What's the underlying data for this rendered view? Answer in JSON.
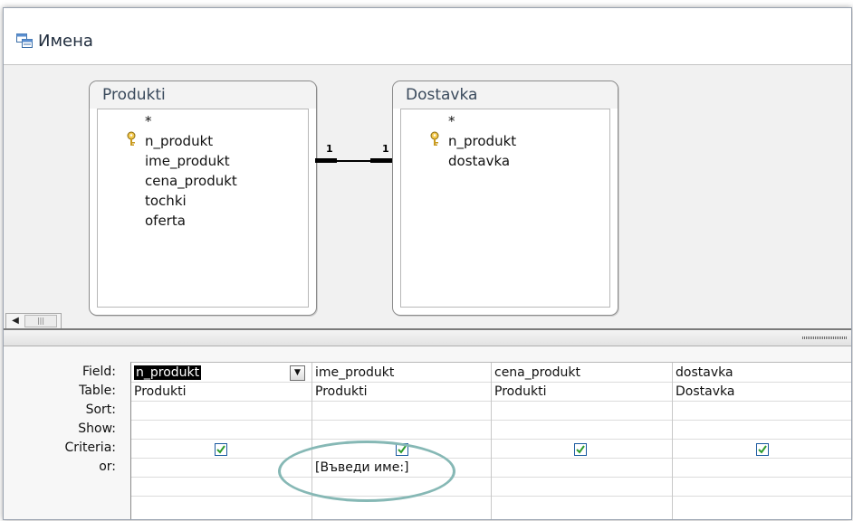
{
  "window": {
    "title": "Имена",
    "icon": "query-design-icon"
  },
  "tables": [
    {
      "name": "Produkti",
      "fields": [
        "*",
        "n_produkt",
        "ime_produkt",
        "cena_produkt",
        "tochki",
        "oferta"
      ],
      "primary_key": "n_produkt"
    },
    {
      "name": "Dostavka",
      "fields": [
        "*",
        "n_produkt",
        "dostavka"
      ],
      "primary_key": "n_produkt"
    }
  ],
  "relationship": {
    "left_label": "1",
    "right_label": "1"
  },
  "grid": {
    "row_labels": [
      "Field:",
      "Table:",
      "Sort:",
      "Show:",
      "Criteria:",
      "or:"
    ],
    "columns": [
      {
        "field": "n_produkt",
        "table": "Produkti",
        "sort": "",
        "show": true,
        "criteria": "",
        "or": ""
      },
      {
        "field": "ime_produkt",
        "table": "Produkti",
        "sort": "",
        "show": true,
        "criteria": "[Въведи име:]",
        "or": ""
      },
      {
        "field": "cena_produkt",
        "table": "Produkti",
        "sort": "",
        "show": true,
        "criteria": "",
        "or": ""
      },
      {
        "field": "dostavka",
        "table": "Dostavka",
        "sort": "",
        "show": true,
        "criteria": "",
        "or": ""
      }
    ]
  },
  "colors": {
    "highlight_oval": "#86b8b5",
    "checkbox_check": "#2e9b2e",
    "selected_bg": "#000000"
  }
}
